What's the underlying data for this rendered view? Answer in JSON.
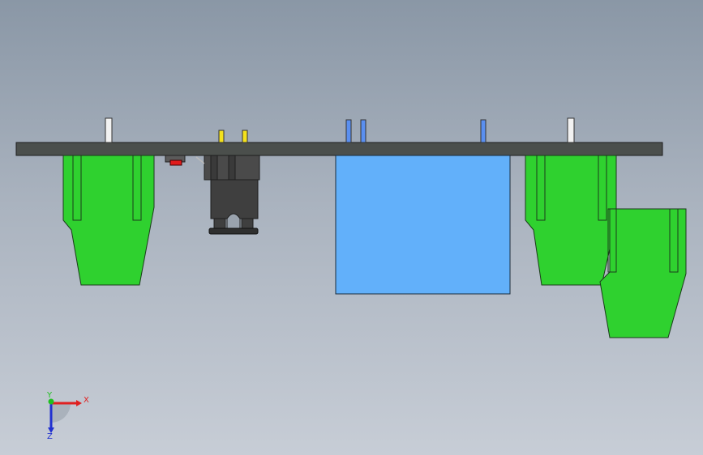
{
  "viewport": {
    "background_top": "#8a97a6",
    "background_bottom": "#c7cdd6"
  },
  "colors": {
    "plate": "#4b4f4c",
    "connector_green": "#2fd12f",
    "connector_outline": "#1b3b1b",
    "module_blue": "#62b0fa",
    "pin_white": "#f2f2f2",
    "pin_yellow": "#f4e21c",
    "pin_blue": "#5a8ff0",
    "relay_dark": "#3f3f3f",
    "indicator_red": "#e01b1b"
  },
  "triad": {
    "x_label": "X",
    "y_label": "Y",
    "z_label": "Z",
    "x_color": "#e02020",
    "y_color": "#20c020",
    "z_color": "#2030d0",
    "icon": "axis-triad-icon"
  }
}
